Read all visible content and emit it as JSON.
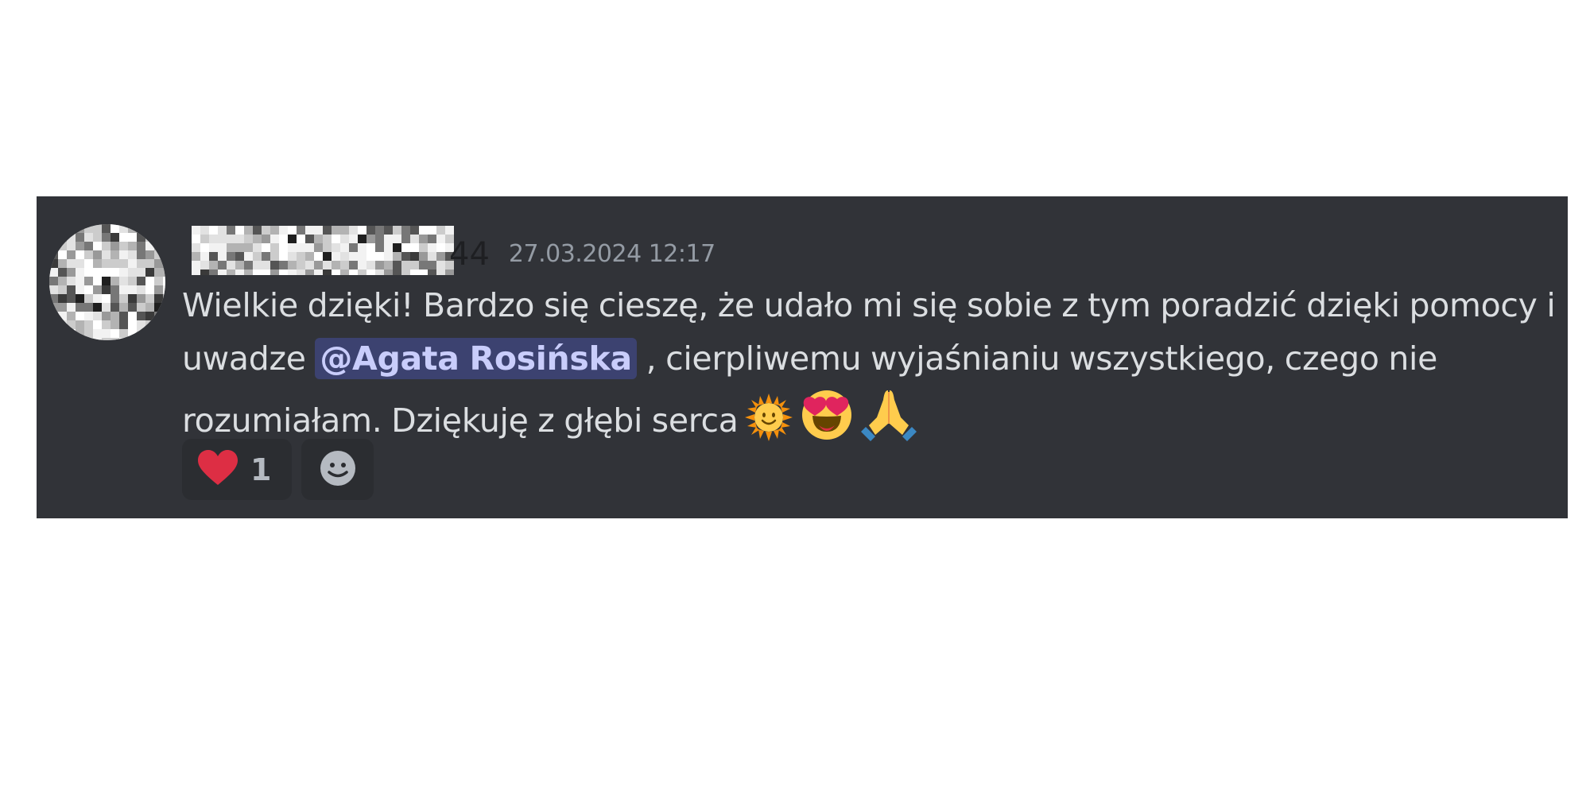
{
  "message": {
    "username_visible_suffix": "44",
    "timestamp": "27.03.2024 12:17",
    "text_before_mention": "Wielkie dzięki! Bardzo się cieszę, że udało mi się sobie z tym poradzić dzięki pomocy i uwadze ",
    "mention": "@Agata Rosińska",
    "text_after_mention": " , cierpliwemu wyjaśnianiu wszystkiego, czego nie rozumiałam. Dziękuję z głębi serca",
    "emojis": [
      "sun-with-face-icon",
      "heart-eyes-icon",
      "folded-hands-icon"
    ]
  },
  "reactions": [
    {
      "icon": "red-heart-icon",
      "count": "1"
    },
    {
      "icon": "add-reaction-icon",
      "count": ""
    }
  ],
  "colors": {
    "message_bg": "#313338",
    "text": "#dbdee1",
    "timestamp": "#949ba4",
    "mention_bg": "#3c4270",
    "mention_text": "#c9cdfb",
    "reaction_bg": "#2b2d31"
  }
}
